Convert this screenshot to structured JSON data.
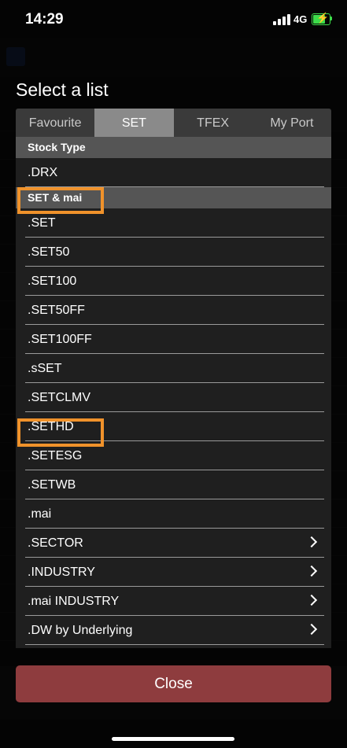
{
  "status_bar": {
    "time": "14:29",
    "network": "4G"
  },
  "modal": {
    "title": "Select a list",
    "tabs": [
      "Favourite",
      "SET",
      "TFEX",
      "My Port"
    ],
    "active_tab": "SET",
    "sections": [
      {
        "header": "Stock Type",
        "items": [
          {
            "label": ".DRX",
            "chevron": false
          }
        ]
      },
      {
        "header": "SET & mai",
        "items": [
          {
            "label": ".SET",
            "chevron": false
          },
          {
            "label": ".SET50",
            "chevron": false
          },
          {
            "label": ".SET100",
            "chevron": false
          },
          {
            "label": ".SET50FF",
            "chevron": false
          },
          {
            "label": ".SET100FF",
            "chevron": false
          },
          {
            "label": ".sSET",
            "chevron": false
          },
          {
            "label": ".SETCLMV",
            "chevron": false
          },
          {
            "label": ".SETHD",
            "chevron": false
          },
          {
            "label": ".SETESG",
            "chevron": false
          },
          {
            "label": ".SETWB",
            "chevron": false
          },
          {
            "label": ".mai",
            "chevron": false
          },
          {
            "label": ".SECTOR",
            "chevron": true
          },
          {
            "label": ".INDUSTRY",
            "chevron": true
          },
          {
            "label": ".mai INDUSTRY",
            "chevron": true
          },
          {
            "label": ".DW by Underlying",
            "chevron": true
          }
        ]
      }
    ],
    "highlighted": [
      "SET & mai",
      ".SETHD"
    ],
    "close_label": "Close"
  },
  "colors": {
    "highlight": "#f0922b",
    "close_button": "#8e3c3e",
    "active_tab": "#8a8a8a",
    "battery": "#3ddc4a"
  }
}
